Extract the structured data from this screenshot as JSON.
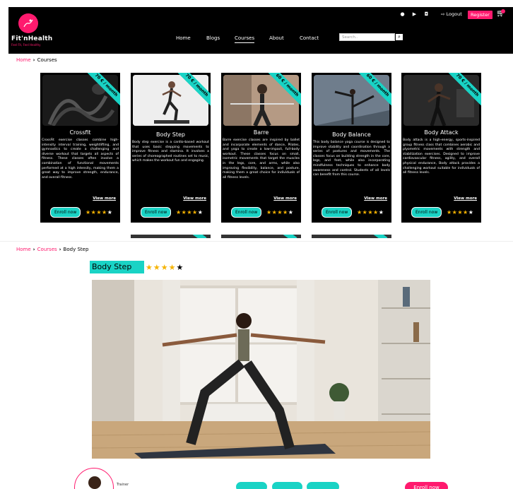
{
  "header": {
    "brand": "Fit'nHealth",
    "tagline": "Feel Fit, Feel Healthy",
    "logout_label": "Logout",
    "register_label": "Register",
    "nav": [
      "Home",
      "Blogs",
      "Courses",
      "About",
      "Contact"
    ],
    "active_nav": "Courses",
    "search_placeholder": "Search.."
  },
  "breadcrumb1": {
    "home": "Home",
    "current": "Courses"
  },
  "cards": [
    {
      "title": "Crossfit",
      "price": "70 € / month",
      "rating": 4,
      "view_more": "View more",
      "enroll": "Enroll now",
      "description": "CrossFit exercise classes combine high-intensity interval training, weightlifting, and gymnastics to create a challenging and diverse workout that targets all aspects of fitness. These classes often involve a combination of functional movements performed at a high intensity, making them a great way to improve strength, endurance, and overall fitness."
    },
    {
      "title": "Body Step",
      "price": "70 € / month",
      "rating": 4,
      "view_more": "View more",
      "enroll": "Enroll now",
      "description": "Body step exercise is a cardio-based workout that uses basic stepping movements to improve fitness and stamina. It involves a series of choreographed routines set to music, which makes the workout fun and engaging."
    },
    {
      "title": "Barre",
      "price": "60 € / month",
      "rating": 4,
      "view_more": "View more",
      "enroll": "Enroll now",
      "description": "Barre exercise classes are inspired by ballet and incorporate elements of dance, Pilates, and yoga to create a low-impact, full-body workout. These classes focus on small, isometric movements that target the muscles in the legs, core, and arms, while also improving flexibility, balance, and posture, making them a great choice for individuals of all fitness levels."
    },
    {
      "title": "Body Balance",
      "price": "60 € / month",
      "rating": 4,
      "view_more": "View more",
      "enroll": "Enroll now",
      "description": "This body balance yoga course is designed to improve stability and coordination through a series of postures and movements. The classes focus on building strength in the core, legs, and feet, while also incorporating mindfulness techniques to enhance body awareness and control. Students of all levels can benefit from this course."
    },
    {
      "title": "Body Attack",
      "price": "70 € / month",
      "rating": 4,
      "view_more": "View more",
      "enroll": "Enroll now",
      "description": "Body attack is a high-energy, sports-inspired group fitness class that combines aerobic and plyometric movements with strength and stabilization exercises. Designed to improve cardiovascular fitness, agility, and overall physical endurance, Body attack provides a challenging workout suitable for individuals of all fitness levels."
    }
  ],
  "breadcrumb2": {
    "home": "Home",
    "courses": "Courses",
    "current": "Body Step"
  },
  "detail": {
    "title": "Body Step",
    "rating": 4,
    "trainer_label": "Trainer",
    "enroll_label": "Enroll now"
  },
  "colors": {
    "accent_pink": "#ff1a6e",
    "accent_teal": "#19d3c5",
    "star": "#f5b301"
  },
  "icons": [
    "facebook-icon",
    "youtube-icon",
    "instagram-icon",
    "logout-icon",
    "cart-icon",
    "search-icon",
    "chevron-right-icon",
    "star-icon"
  ]
}
